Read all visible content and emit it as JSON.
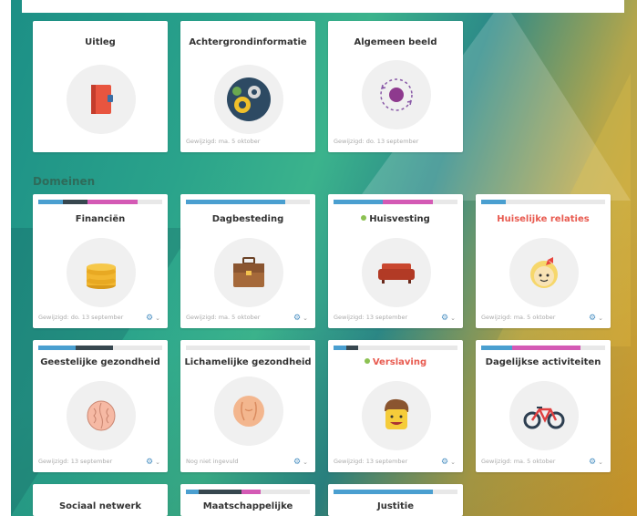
{
  "top_cards": [
    {
      "title": "Uitleg",
      "modified": ""
    },
    {
      "title": "Achtergrondinformatie",
      "modified": "Gewijzigd: ma. 5 oktober"
    },
    {
      "title": "Algemeen beeld",
      "modified": "Gewijzigd: do. 13 september"
    }
  ],
  "section_title": "Domeinen",
  "domains": [
    {
      "title": "Financiën",
      "modified": "Gewijzigd: do. 13 september",
      "progress": [
        {
          "color": "#4a9fd0",
          "value": 0.2
        },
        {
          "color": "#37474f",
          "value": 0.2
        },
        {
          "color": "#d45ab5",
          "value": 0.4
        }
      ]
    },
    {
      "title": "Dagbesteding",
      "modified": "Gewijzigd: ma. 5 oktober",
      "progress": [
        {
          "color": "#4a9fd0",
          "value": 0.8
        }
      ]
    },
    {
      "title": "Huisvesting",
      "modified": "Gewijzigd: 13 september",
      "progress": [
        {
          "color": "#4a9fd0",
          "value": 0.4
        },
        {
          "color": "#d45ab5",
          "value": 0.4
        }
      ]
    },
    {
      "title": "Huiselijke relaties",
      "modified": "Gewijzigd: ma. 5 oktober",
      "progress": [
        {
          "color": "#4a9fd0",
          "value": 0.2
        }
      ]
    },
    {
      "title": "Geestelijke gezondheid",
      "modified": "Gewijzigd: 13 september",
      "progress": [
        {
          "color": "#4a9fd0",
          "value": 0.3
        },
        {
          "color": "#37474f",
          "value": 0.3
        }
      ]
    },
    {
      "title": "Lichamelijke gezondheid",
      "modified": "Nog niet ingevuld",
      "progress": []
    },
    {
      "title": "Verslaving",
      "modified": "Gewijzigd: 13 september",
      "progress": [
        {
          "color": "#4a9fd0",
          "value": 0.1
        },
        {
          "color": "#37474f",
          "value": 0.1
        }
      ]
    },
    {
      "title": "Dagelijkse activiteiten",
      "modified": "Gewijzigd: ma. 5 oktober",
      "progress": [
        {
          "color": "#4a9fd0",
          "value": 0.25
        },
        {
          "color": "#d45ab5",
          "value": 0.55
        }
      ]
    }
  ],
  "bottom_cards": [
    {
      "title": "Sociaal netwerk",
      "progress": []
    },
    {
      "title": "Maatschappelijke",
      "progress": [
        {
          "color": "#4a9fd0",
          "value": 0.1
        },
        {
          "color": "#37474f",
          "value": 0.35
        },
        {
          "color": "#d45ab5",
          "value": 0.15
        }
      ]
    },
    {
      "title": "Justitie",
      "progress": [
        {
          "color": "#4a9fd0",
          "value": 0.8
        }
      ]
    }
  ],
  "colors": {
    "accent": "#4a90c2",
    "alert": "#e85a4f",
    "status_dot": "#8cc152"
  }
}
